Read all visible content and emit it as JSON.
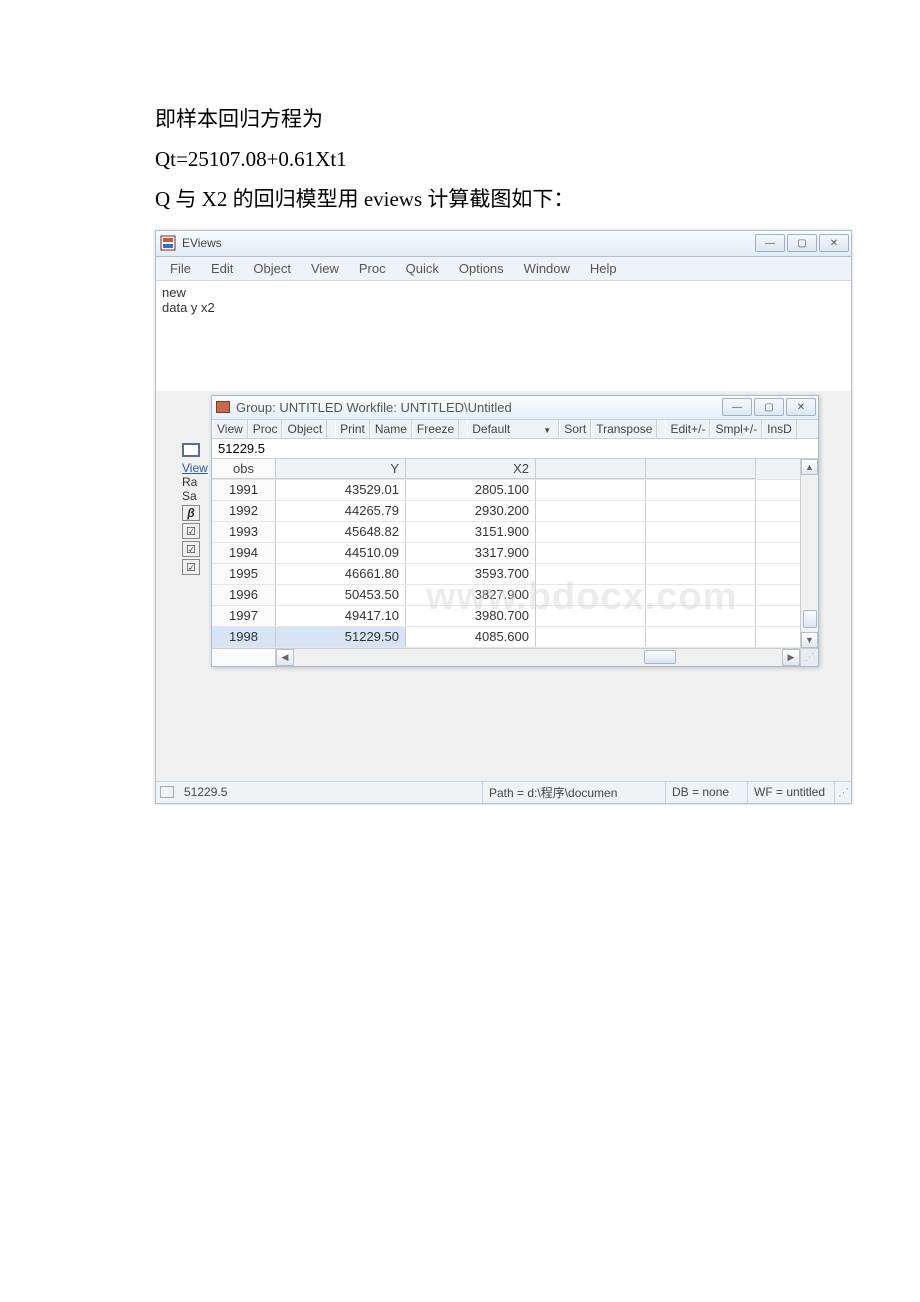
{
  "doc_lines": {
    "l1": "即样本回归方程为",
    "l2": "Qt=25107.08+0.61Xt1",
    "l3": "Q 与 X2 的回归模型用 eviews 计算截图如下："
  },
  "app": {
    "title": "EViews",
    "cmd": {
      "line1": "new",
      "line2": "data y x2"
    }
  },
  "menu": {
    "file": "File",
    "edit": "Edit",
    "object": "Object",
    "view": "View",
    "proc": "Proc",
    "quick": "Quick",
    "options": "Options",
    "window": "Window",
    "help": "Help"
  },
  "group": {
    "title": "Group: UNTITLED   Workfile: UNTITLED\\Untitled",
    "toolbar": {
      "view": "View",
      "proc": "Proc",
      "object": "Object",
      "print": "Print",
      "name": "Name",
      "freeze": "Freeze",
      "default": "Default",
      "sort": "Sort",
      "transpose": "Transpose",
      "editpm": "Edit+/-",
      "smplpm": "Smpl+/-",
      "insdel": "InsD"
    },
    "value_row": "51229.5",
    "headers": {
      "obs": "obs",
      "y": "Y",
      "x2": "X2"
    },
    "chart_data": {
      "type": "table",
      "columns": [
        "obs",
        "Y",
        "X2"
      ],
      "rows": [
        {
          "obs": "1991",
          "y": "43529.01",
          "x2": "2805.100"
        },
        {
          "obs": "1992",
          "y": "44265.79",
          "x2": "2930.200"
        },
        {
          "obs": "1993",
          "y": "45648.82",
          "x2": "3151.900"
        },
        {
          "obs": "1994",
          "y": "44510.09",
          "x2": "3317.900"
        },
        {
          "obs": "1995",
          "y": "46661.80",
          "x2": "3593.700"
        },
        {
          "obs": "1996",
          "y": "50453.50",
          "x2": "3827.900"
        },
        {
          "obs": "1997",
          "y": "49417.10",
          "x2": "3980.700"
        },
        {
          "obs": "1998",
          "y": "51229.50",
          "x2": "4085.600"
        }
      ]
    }
  },
  "bgstack": {
    "view": "View",
    "ra": "Ra",
    "sa": "Sa",
    "beta": "β"
  },
  "status": {
    "left_left": "",
    "left": "51229.5",
    "path": "Path = d:\\程序\\documen",
    "db": "DB = none",
    "wf": "WF = untitled"
  },
  "watermark": "www.bdocx.com"
}
